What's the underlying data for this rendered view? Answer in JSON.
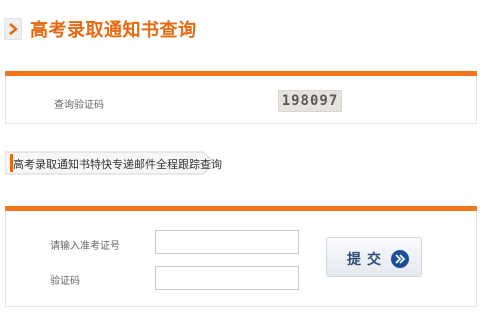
{
  "header": {
    "title": "高考录取通知书查询",
    "icon": "chevron-right-icon",
    "accent": "#e86a10"
  },
  "section1": {
    "label": "查询验证码",
    "captcha": "198097"
  },
  "section2": {
    "tab_title": "高考录取通知书特快专递邮件全程跟踪查询",
    "fields": [
      {
        "label": "请输入准考证号",
        "value": "",
        "placeholder": ""
      },
      {
        "label": "验证码",
        "value": "",
        "placeholder": ""
      }
    ],
    "submit_label": "提交",
    "submit_icon": "double-chevron-right-icon"
  },
  "colors": {
    "orange": "#f3761b",
    "button_text": "#2d4c7c",
    "icon_blue": "#1b4e9a"
  }
}
